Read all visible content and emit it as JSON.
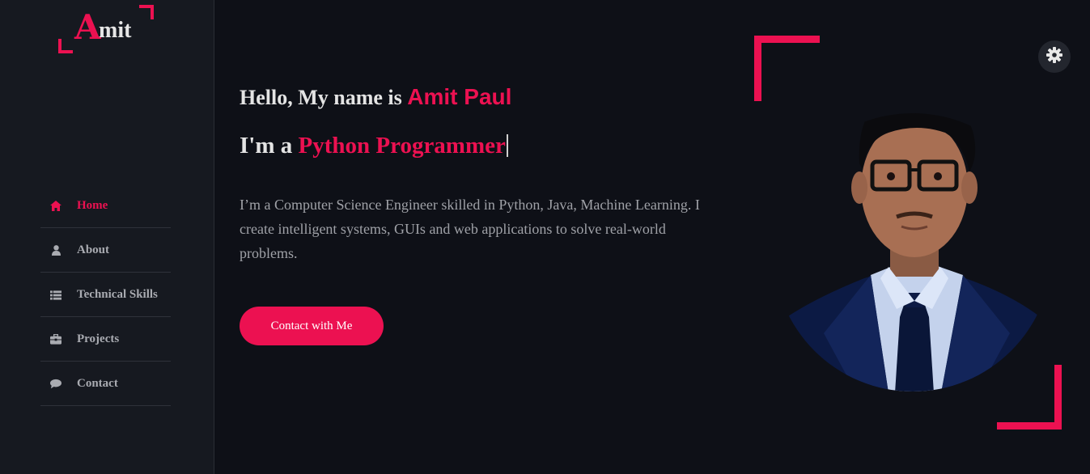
{
  "logo": {
    "initial": "A",
    "rest": "mit"
  },
  "nav": {
    "items": [
      {
        "label": "Home",
        "icon": "home-icon",
        "active": true
      },
      {
        "label": "About",
        "icon": "user-icon",
        "active": false
      },
      {
        "label": "Technical Skills",
        "icon": "list-icon",
        "active": false
      },
      {
        "label": "Projects",
        "icon": "briefcase-icon",
        "active": false
      },
      {
        "label": "Contact",
        "icon": "comment-icon",
        "active": false
      }
    ]
  },
  "hero": {
    "greeting": "Hello, My name is",
    "name": "Amit Paul",
    "role_prefix": "I'm a",
    "role": "Python Programmer",
    "description": "I’m a Computer Science Engineer skilled in Python, Java, Machine Learning. I create intelligent systems, GUIs and web applications to solve real-world problems.",
    "cta": "Contact with Me"
  },
  "settings": {
    "icon": "gear-icon"
  },
  "colors": {
    "accent": "#ec1151",
    "background": "#0e1017",
    "sidebar": "#161920",
    "text": "#e4e4e4",
    "muted": "#9fa1a7"
  }
}
